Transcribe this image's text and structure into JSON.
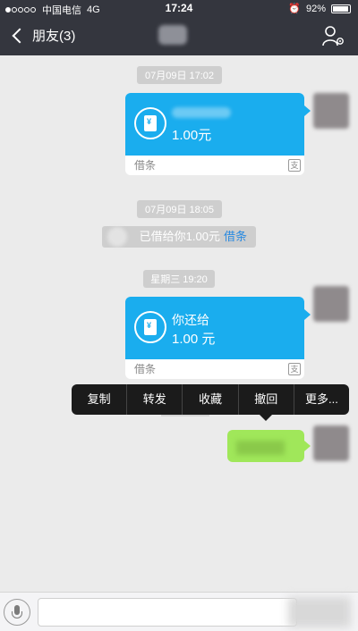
{
  "status": {
    "carrier": "中国电信",
    "network": "4G",
    "time": "17:24",
    "battery": "92%"
  },
  "nav": {
    "back_label": "朋友(3)"
  },
  "messages": {
    "ts1": "07月09日 17:02",
    "card1": {
      "amount": "1.00元",
      "footer": "借条"
    },
    "ts2": "07月09日 18:05",
    "notice": {
      "text": "已借给你1.00元",
      "link": "借条"
    },
    "ts3": "星期三 19:20",
    "card2": {
      "title": "你还给",
      "amount": "1.00 元",
      "footer": "借条"
    }
  },
  "context_menu": [
    "复制",
    "转发",
    "收藏",
    "撤回",
    "更多..."
  ],
  "colors": {
    "nav_bg": "#34363e",
    "card_blue": "#1aadee",
    "bubble_green": "#a0e75a",
    "menu_bg": "#1b1b1b"
  }
}
